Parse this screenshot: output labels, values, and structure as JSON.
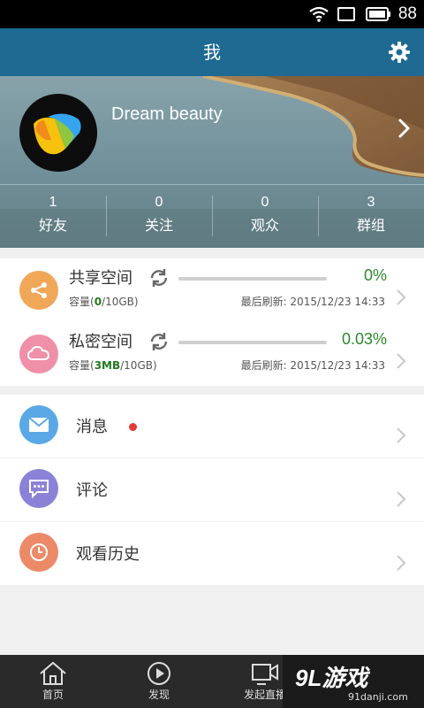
{
  "status_bar": {
    "battery_level": "88"
  },
  "header": {
    "title": "我"
  },
  "profile": {
    "username": "Dream beauty",
    "stats": [
      {
        "count": "1",
        "label": "好友"
      },
      {
        "count": "0",
        "label": "关注"
      },
      {
        "count": "0",
        "label": "观众"
      },
      {
        "count": "3",
        "label": "群组"
      }
    ]
  },
  "storage": [
    {
      "title": "共享空间",
      "percent_text": "0%",
      "progress_fraction": 0.0,
      "capacity_prefix": "容量(",
      "used": "0",
      "total": "/10GB)",
      "last_refresh": "最后刷新: 2015/12/23 14:33",
      "icon": "share-icon",
      "icon_color": "#f0a858"
    },
    {
      "title": "私密空间",
      "percent_text": "0.03%",
      "progress_fraction": 0.0003,
      "capacity_prefix": "容量(",
      "used": "3MB",
      "total": "/10GB)",
      "last_refresh": "最后刷新: 2015/12/23 14:33",
      "icon": "cloud-icon",
      "icon_color": "#ef8fa8"
    }
  ],
  "menu": [
    {
      "label": "消息",
      "icon": "mail-icon",
      "icon_color": "#5aa9e6",
      "has_badge": true
    },
    {
      "label": "评论",
      "icon": "comment-icon",
      "icon_color": "#8b82d8",
      "has_badge": false
    },
    {
      "label": "观看历史",
      "icon": "clock-icon",
      "icon_color": "#ec8a68",
      "has_badge": false
    }
  ],
  "bottom_nav": [
    {
      "label": "首页",
      "icon": "home-icon"
    },
    {
      "label": "发现",
      "icon": "discover-icon"
    },
    {
      "label": "发起直播",
      "icon": "video-camera-icon"
    }
  ],
  "watermark": {
    "logo": "9L游戏",
    "url": "91danji.com"
  },
  "colors": {
    "header": "#1e6a92",
    "accent_green": "#2b8a2b",
    "badge": "#e53935"
  }
}
